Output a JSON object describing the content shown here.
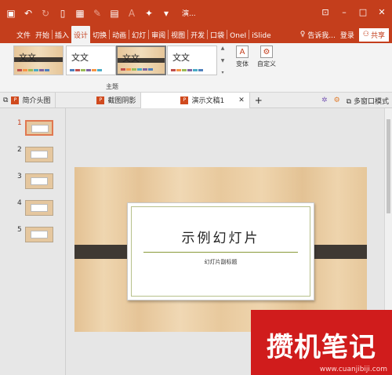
{
  "window": {
    "title": "演..."
  },
  "quick_access": {
    "icons": [
      "save-icon",
      "undo-icon",
      "redo-icon",
      "new-icon",
      "present-icon",
      "format-painter-icon",
      "picture-icon",
      "font-color-icon",
      "shapes-icon",
      "more-icon"
    ]
  },
  "menu": {
    "tabs": [
      "文件",
      "开始",
      "插入",
      "设计",
      "切换",
      "动画",
      "幻灯",
      "审阅",
      "视图",
      "开发",
      "口袋",
      "OneI",
      "iSlide"
    ],
    "active_tab": "设计",
    "tell_me": "告诉我...",
    "login": "登录",
    "share": "共享"
  },
  "ribbon": {
    "themes": [
      {
        "label": "文文",
        "style": "wood"
      },
      {
        "label": "文文",
        "style": "plain"
      },
      {
        "label": "文文",
        "style": "wood"
      },
      {
        "label": "文文",
        "style": "plain"
      }
    ],
    "variants_button": "变体",
    "customize_button": "自定义",
    "group_label": "主题"
  },
  "doc_tabs": [
    {
      "label": "简介头图"
    },
    {
      "label": "截图阴影"
    },
    {
      "label": "演示文稿1"
    }
  ],
  "doc_right": {
    "multi_window": "多窗口模式"
  },
  "thumbnails": [
    "1",
    "2",
    "3",
    "4",
    "5"
  ],
  "slide": {
    "title": "示例幻灯片",
    "subtitle": "幻灯片副标题"
  },
  "watermark": {
    "text": "攒机笔记",
    "url": "www.cuanjibiji.com"
  },
  "colors": {
    "accent": "#c43e1c",
    "ribbon_bg": "#f3f3f3",
    "watermark": "#d01c1c"
  }
}
